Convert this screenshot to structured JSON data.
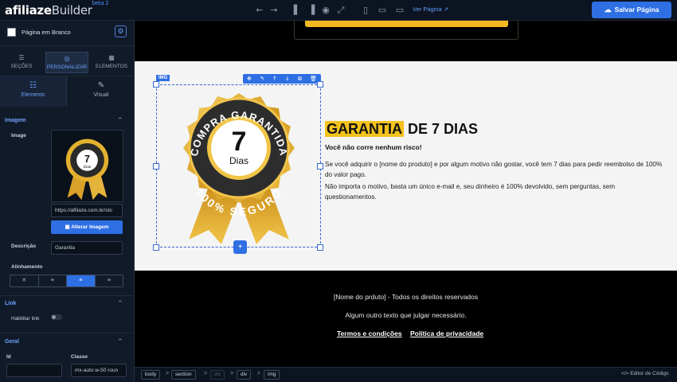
{
  "app": {
    "logo_main": "afiliaze",
    "logo_sub": "Builder",
    "logo_badge": "beta 2",
    "ver_pagina": "Ver Página",
    "save_label": "Salvar Página"
  },
  "sidebar": {
    "page_name": "Página em Branco",
    "main_tabs": [
      {
        "label": "SEÇÕES",
        "icon": "sections-icon"
      },
      {
        "label": "PERSONALIZAR",
        "icon": "palette-icon"
      },
      {
        "label": "ELEMENTOS",
        "icon": "grid-icon"
      }
    ],
    "sub_tabs": [
      {
        "label": "Elemento",
        "icon": "sliders-icon"
      },
      {
        "label": "Visual",
        "icon": "brush-icon"
      }
    ],
    "section_imagem": "Imagem",
    "image_label": "Image",
    "image_url": "https://afiliaze.com.br/sto",
    "change_image": "Alterar Imagem",
    "descricao_label": "Descrição",
    "descricao_value": "Garantia",
    "alinhamento_label": "Alinhamento",
    "section_link": "Link",
    "habilitar_link": "Habilitar link",
    "section_geral": "Geral",
    "id_label": "Id",
    "id_value": "",
    "classe_label": "Classe",
    "classe_value": "mx-auto w-50 roun"
  },
  "canvas": {
    "img_tag": "IMG",
    "badge": {
      "top_text": "COMPRA GARANTIDA",
      "number": "7",
      "unit": "Dias",
      "bottom_text": "100% SEGURO"
    },
    "title_highlight": "GARANTIA",
    "title_rest": "DE 7 DIAS",
    "subtitle": "Você não corre nenhum risco!",
    "para1": "Se você adquirir o [nome do produto] e por algum motivo não gostar, você tem 7 dias para pedir reembolso de 100% do valor pago.",
    "para2": "Não importa o motivo, basta um único e-mail e, seu dinheiro é 100% devolvido, sem perguntas, sem questionamentos.",
    "footer_line1": "[Nome do prduto] - Todos os direitos reservados",
    "footer_line2": "Algum outro texto que julgar necessário.",
    "footer_link1": "Termos e condições",
    "footer_link2": "Política de privacidade"
  },
  "statusbar": {
    "crumbs": [
      "body",
      "section",
      "div",
      "div",
      "img"
    ],
    "code_editor": "Editor de Código"
  },
  "colors": {
    "accent": "#2f6fe4",
    "highlight": "#f3c21d",
    "gold": "#e2a92a"
  }
}
